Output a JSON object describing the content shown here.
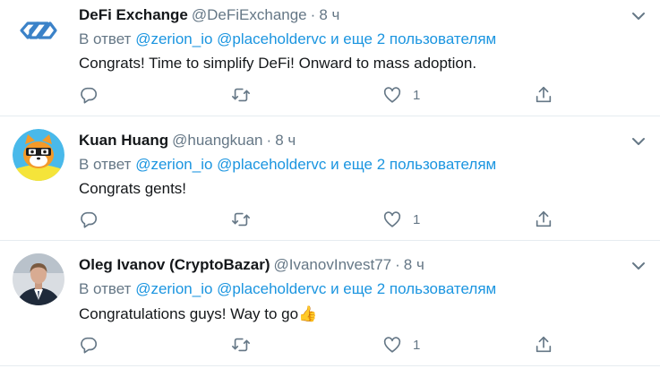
{
  "colors": {
    "text": "#14171a",
    "secondary": "#657786",
    "link": "#1b95e0",
    "divider": "#e6ecf0"
  },
  "tweets": [
    {
      "avatar_icon": "defi-exchange-logo-icon",
      "display_name": "DeFi Exchange",
      "handle": "@DeFiExchange",
      "separator": "·",
      "time": "8 ч",
      "reply_prefix": "В ответ",
      "mention_1": "@zerion_io",
      "mention_2": "@placeholdervc",
      "reply_suffix": "и еще 2 пользователям",
      "text": "Congrats! Time to simplify DeFi! Onward to mass adoption.",
      "like_count": "1"
    },
    {
      "avatar_icon": "cartoon-fox-avatar-icon",
      "display_name": "Kuan Huang",
      "handle": "@huangkuan",
      "separator": "·",
      "time": "8 ч",
      "reply_prefix": "В ответ",
      "mention_1": "@zerion_io",
      "mention_2": "@placeholdervc",
      "reply_suffix": "и еще 2 пользователям",
      "text": "Congrats gents!",
      "like_count": "1"
    },
    {
      "avatar_icon": "man-in-suit-avatar-icon",
      "display_name": "Oleg Ivanov (CryptoBazar)",
      "handle": "@IvanovInvest77",
      "separator": "·",
      "time": "8 ч",
      "reply_prefix": "В ответ",
      "mention_1": "@zerion_io",
      "mention_2": "@placeholdervc",
      "reply_suffix": "и еще 2 пользователям",
      "text": "Congratulations guys! Way to go",
      "emoji": "👍",
      "like_count": "1"
    }
  ]
}
